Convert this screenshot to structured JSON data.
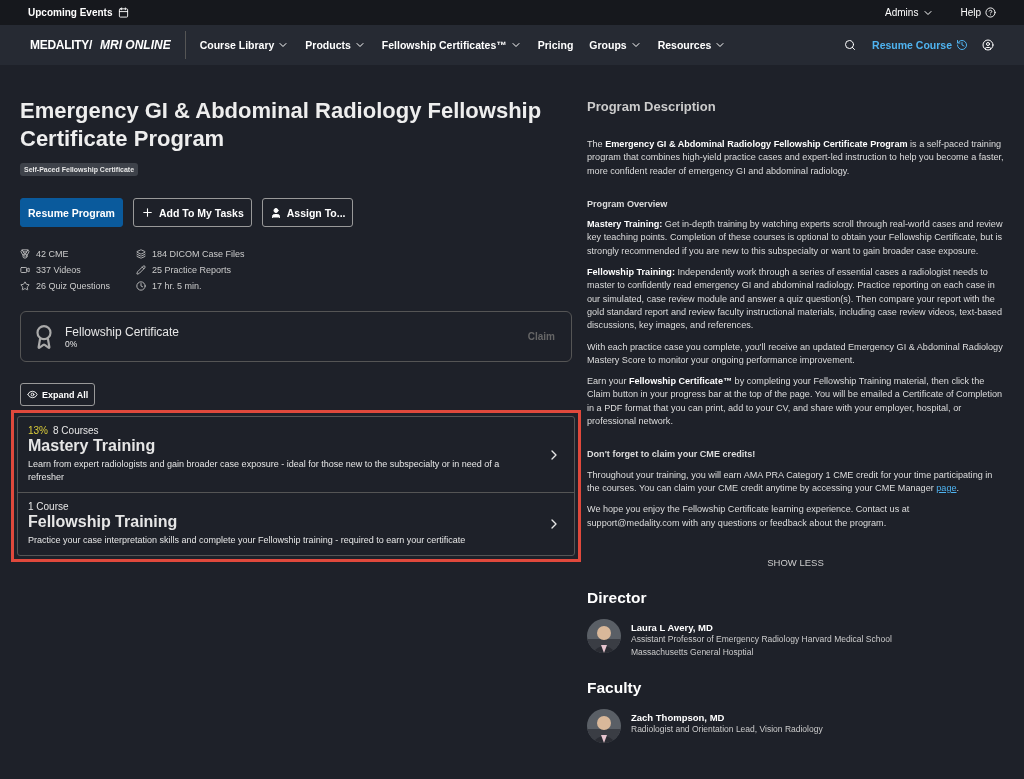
{
  "top_bar": {
    "events": "Upcoming Events",
    "admins": "Admins",
    "help": "Help"
  },
  "nav": {
    "logo_left": "MEDALITY/",
    "logo_right": "MRI ONLINE",
    "items": [
      {
        "label": "Course Library",
        "dropdown": true
      },
      {
        "label": "Products",
        "dropdown": true
      },
      {
        "label": "Fellowship Certificates™",
        "dropdown": true
      },
      {
        "label": "Pricing",
        "dropdown": false
      },
      {
        "label": "Groups",
        "dropdown": true
      },
      {
        "label": "Resources",
        "dropdown": true
      }
    ],
    "resume": "Resume Course"
  },
  "program": {
    "title": "Emergency GI & Abdominal Radiology Fellowship Certificate Program",
    "tag": "Self-Paced Fellowship Certificate",
    "buttons": [
      {
        "label": "Resume Program",
        "kind": "primary"
      },
      {
        "label": "Add To My Tasks",
        "kind": "add"
      },
      {
        "label": "Assign To...",
        "kind": "assign"
      }
    ],
    "stats": [
      {
        "text": "42 CME",
        "kind": "medal"
      },
      {
        "text": "184 DICOM Case Files",
        "kind": "layers"
      },
      {
        "text": "337 Videos",
        "kind": "video"
      },
      {
        "text": "25 Practice Reports",
        "kind": "pencil"
      },
      {
        "text": "26 Quiz Questions",
        "kind": "star"
      },
      {
        "text": "17 hr. 5 min.",
        "kind": "clock"
      }
    ],
    "certificate": {
      "title": "Fellowship Certificate",
      "percent": "0%",
      "claim": "Claim",
      "claim_disabled": true
    },
    "expand": "Expand All",
    "trainings": [
      {
        "progress": "13%",
        "count": "8 Courses",
        "title": "Mastery Training",
        "description": "Learn from expert radiologists and gain broader case exposure - ideal for those new to the subspecialty or in need of a refresher"
      },
      {
        "count": "1 Course",
        "title": "Fellowship Training",
        "description": "Practice your case interpretation skills and complete your Fellowship training - required to earn your certificate"
      }
    ]
  },
  "description": {
    "heading": "Program Description",
    "paragraphs": [
      {
        "kind": "text",
        "text": "The **Emergency GI & Abdominal Radiology Fellowship Certificate Program** is a self-paced training program that combines high-yield practice cases and expert-led instruction to help you become a faster, more confident reader of emergency GI and abdominal radiology."
      },
      {
        "kind": "heading",
        "text": "Program Overview"
      },
      {
        "kind": "text",
        "text": "**Mastery Training:** Get in-depth training by watching experts scroll through real-world cases and review key teaching points. Completion of these courses is optional to obtain your Fellowship Certificate, but is strongly recommended if you are new to this subspecialty or want to gain broader case exposure."
      },
      {
        "kind": "text",
        "text": "**Fellowship Training:** Independently work through a series of essential cases a radiologist needs to master to confidently read emergency GI and abdominal radiology. Practice reporting on each case in our simulated, case review module and answer a quiz question(s). Then compare your report with the gold standard report and review faculty instructional materials, including case review videos, text-based discussions, key images, and references."
      },
      {
        "kind": "text",
        "text": "With each practice case you complete, you'll receive an updated Emergency GI & Abdominal Radiology Mastery Score to monitor your ongoing performance improvement."
      },
      {
        "kind": "text",
        "text": "Earn your **Fellowship Certificate™** by completing your Fellowship Training material, then click the Claim button in your progress bar at the top of the page. You will be emailed a Certificate of Completion in a PDF format that you can print, add to your CV, and share with your employer, hospital, or professional network."
      },
      {
        "kind": "heading",
        "text": "Don't forget to claim your CME credits!"
      },
      {
        "kind": "link",
        "text": "Throughout your training, you will earn AMA PRA Category 1 CME credit for your time participating in the courses. You can claim your CME credit anytime by accessing your CME Manager ",
        "link": "page",
        "after": "."
      },
      {
        "kind": "text",
        "text": "We hope you enjoy the Fellowship Certificate learning experience. Contact us at support@medality.com with any questions or feedback about the program."
      }
    ],
    "show_less": "SHOW LESS"
  },
  "director": {
    "heading": "Director",
    "people": [
      {
        "name": "Laura L Avery, MD",
        "lines": [
          "Assistant Professor of Emergency Radiology Harvard Medical School",
          "Massachusetts General Hosptial"
        ]
      }
    ]
  },
  "faculty": {
    "heading": "Faculty",
    "people": [
      {
        "name": "Zach Thompson, MD",
        "lines": [
          "Radiologist and Orientation Lead, Vision Radiology"
        ]
      }
    ]
  }
}
